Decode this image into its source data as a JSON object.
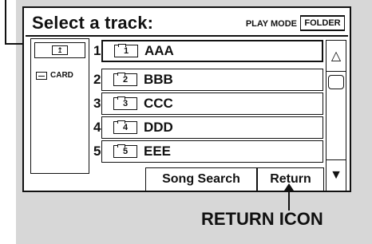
{
  "header": {
    "title": "Select a track:",
    "play_mode_label": "PLAY MODE",
    "folder_button": "FOLDER"
  },
  "sidebar": {
    "up_folder_glyph": "↥",
    "card_label": "CARD"
  },
  "tracks": [
    {
      "number": "1",
      "folder_num": "1",
      "name": "AAA"
    },
    {
      "number": "2",
      "folder_num": "2",
      "name": "BBB"
    },
    {
      "number": "3",
      "folder_num": "3",
      "name": "CCC"
    },
    {
      "number": "4",
      "folder_num": "4",
      "name": "DDD"
    },
    {
      "number": "5",
      "folder_num": "5",
      "name": "EEE"
    }
  ],
  "buttons": {
    "song_search": "Song Search",
    "return": "Return"
  },
  "scroll": {
    "up_glyph": "△",
    "down_glyph": "▼"
  },
  "annotation": {
    "return_icon_label": "RETURN ICON"
  },
  "colors": {
    "background_panel": "#d7d7d7",
    "screen": "#ffffff",
    "ink": "#111111"
  }
}
